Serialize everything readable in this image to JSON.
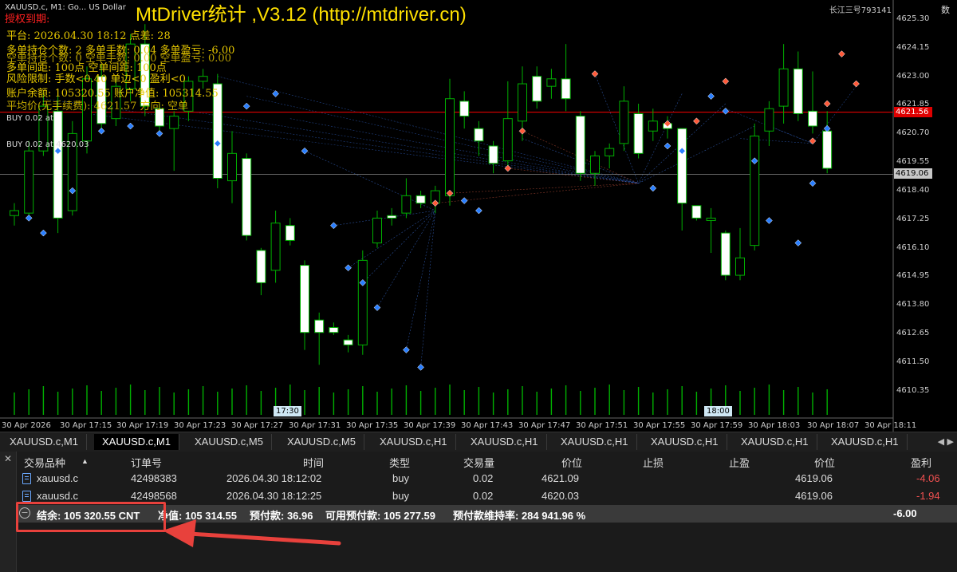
{
  "watermark": "MtDriver统计 ,V3.12 (http://mtdriver.cn)",
  "chart_header": {
    "symbol_line": "XAUUSD.c, M1:  Go...  US Dollar",
    "red_text": "授权到期:",
    "broker": "长江三号793141",
    "right_cut": "数"
  },
  "overlay_lines": [
    "平台: 2026.04.30 18:12       点差: 28",
    "多单持仓个数: 2   多单手数: 0.04   多单盈亏: -6.00",
    "空单持仓个数: 0   空单手数: 0.00   空单盈亏: 0.00",
    "多单间距: 100点   空单间距: 100点",
    "风险限制: 手数<0.40 单边<0 盈利<0",
    "账户余额: 105320.55   账户净值: 105314.55",
    "平均价(无手续费): 4621.57  方向: 空单"
  ],
  "buy_labels": [
    "BUY 0.02 at",
    "BUY 0.02 at 4620.03"
  ],
  "price_axis": [
    "4625.30",
    "4624.15",
    "4623.00",
    "4621.85",
    "4620.70",
    "4619.55",
    "4618.40",
    "4617.25",
    "4616.10",
    "4614.95",
    "4613.80",
    "4612.65",
    "4611.50",
    "4610.35"
  ],
  "price_tags": {
    "red_line": "4621.56",
    "current": "4619.06"
  },
  "time_axis": [
    "30 Apr 2026",
    "30 Apr 17:15",
    "30 Apr 17:19",
    "30 Apr 17:23",
    "30 Apr 17:27",
    "30 Apr 17:31",
    "30 Apr 17:35",
    "30 Apr 17:39",
    "30 Apr 17:43",
    "30 Apr 17:47",
    "30 Apr 17:51",
    "30 Apr 17:55",
    "30 Apr 17:59",
    "30 Apr 18:03",
    "30 Apr 18:07",
    "30 Apr 18:11"
  ],
  "time_badges": [
    "17:30",
    "18:00"
  ],
  "tabs": [
    "XAUUSD.c,M1",
    "XAUUSD.c,M1",
    "XAUUSD.c,M5",
    "XAUUSD.c,M5",
    "XAUUSD.c,H1",
    "XAUUSD.c,H1",
    "XAUUSD.c,H1",
    "XAUUSD.c,H1",
    "XAUUSD.c,H1",
    "XAUUSD.c,H1"
  ],
  "table": {
    "headers": {
      "symbol": "交易品种",
      "ticket": "订单号",
      "time": "时间",
      "type": "类型",
      "volume": "交易量",
      "price": "价位",
      "sl": "止损",
      "tp": "止盈",
      "cur_price": "价位",
      "profit": "盈利"
    },
    "rows": [
      {
        "symbol": "xauusd.c",
        "ticket": "42498383",
        "time": "2026.04.30 18:12:02",
        "type": "buy",
        "volume": "0.02",
        "price": "4621.09",
        "cur_price": "4619.06",
        "profit": "-4.06"
      },
      {
        "symbol": "xauusd.c",
        "ticket": "42498568",
        "time": "2026.04.30 18:12:25",
        "type": "buy",
        "volume": "0.02",
        "price": "4620.03",
        "cur_price": "4619.06",
        "profit": "-1.94"
      }
    ],
    "summary": {
      "balance": "结余: 105 320.55 CNT",
      "equity": "净值: 105 314.55",
      "margin": "预付款: 36.96",
      "free_margin": "可用预付款: 105 277.59",
      "margin_level": "预付款维持率: 284 941.96 %",
      "total": "-6.00"
    }
  },
  "colors": {
    "bull": "#00b000",
    "bear": "#ffffff",
    "price_line": "#ff2020",
    "highlight": "#e8413c"
  },
  "chart_data": {
    "type": "candlestick",
    "symbol": "XAUUSD.c",
    "timeframe": "M1",
    "ylim": [
      4610.35,
      4625.3
    ],
    "candles": [
      {
        "o": 4617.4,
        "h": 4617.9,
        "l": 4617.0,
        "c": 4617.6
      },
      {
        "o": 4617.5,
        "h": 4620.4,
        "l": 4617.3,
        "c": 4620.0
      },
      {
        "o": 4620.0,
        "h": 4622.4,
        "l": 4619.8,
        "c": 4621.8
      },
      {
        "o": 4621.6,
        "h": 4622.3,
        "l": 4616.7,
        "c": 4617.3
      },
      {
        "o": 4617.6,
        "h": 4621.2,
        "l": 4617.4,
        "c": 4620.7
      },
      {
        "o": 4620.4,
        "h": 4623.4,
        "l": 4619.9,
        "c": 4622.9
      },
      {
        "o": 4623.0,
        "h": 4623.5,
        "l": 4620.8,
        "c": 4621.1
      },
      {
        "o": 4621.3,
        "h": 4623.0,
        "l": 4621.0,
        "c": 4622.6
      },
      {
        "o": 4622.5,
        "h": 4624.7,
        "l": 4622.0,
        "c": 4624.3
      },
      {
        "o": 4624.3,
        "h": 4625.1,
        "l": 4621.4,
        "c": 4621.8
      },
      {
        "o": 4621.7,
        "h": 4621.9,
        "l": 4620.8,
        "c": 4621.0
      },
      {
        "o": 4620.9,
        "h": 4621.6,
        "l": 4619.2,
        "c": 4621.4
      },
      {
        "o": 4621.6,
        "h": 4623.0,
        "l": 4621.2,
        "c": 4622.8
      },
      {
        "o": 4622.8,
        "h": 4623.3,
        "l": 4622.5,
        "c": 4623.0
      },
      {
        "o": 4622.7,
        "h": 4623.1,
        "l": 4618.5,
        "c": 4618.9
      },
      {
        "o": 4618.8,
        "h": 4620.8,
        "l": 4617.9,
        "c": 4619.9
      },
      {
        "o": 4619.7,
        "h": 4619.9,
        "l": 4616.4,
        "c": 4616.6
      },
      {
        "o": 4616.0,
        "h": 4616.1,
        "l": 4614.2,
        "c": 4614.7
      },
      {
        "o": 4615.2,
        "h": 4617.6,
        "l": 4614.7,
        "c": 4617.1
      },
      {
        "o": 4617.0,
        "h": 4617.3,
        "l": 4616.2,
        "c": 4616.4
      },
      {
        "o": 4615.4,
        "h": 4615.6,
        "l": 4612.0,
        "c": 4612.7
      },
      {
        "o": 4613.2,
        "h": 4613.5,
        "l": 4611.4,
        "c": 4612.7
      },
      {
        "o": 4612.9,
        "h": 4613.1,
        "l": 4612.6,
        "c": 4612.7
      },
      {
        "o": 4612.4,
        "h": 4612.6,
        "l": 4611.9,
        "c": 4612.2
      },
      {
        "o": 4612.2,
        "h": 4616.0,
        "l": 4611.8,
        "c": 4615.6
      },
      {
        "o": 4616.3,
        "h": 4617.6,
        "l": 4616.1,
        "c": 4617.3
      },
      {
        "o": 4617.4,
        "h": 4617.7,
        "l": 4617.0,
        "c": 4617.3
      },
      {
        "o": 4617.5,
        "h": 4618.9,
        "l": 4617.3,
        "c": 4618.2
      },
      {
        "o": 4618.2,
        "h": 4618.4,
        "l": 4617.7,
        "c": 4617.9
      },
      {
        "o": 4617.9,
        "h": 4618.6,
        "l": 4617.5,
        "c": 4618.4
      },
      {
        "o": 4618.2,
        "h": 4622.9,
        "l": 4617.8,
        "c": 4622.1
      },
      {
        "o": 4622.0,
        "h": 4622.4,
        "l": 4620.9,
        "c": 4621.4
      },
      {
        "o": 4620.9,
        "h": 4621.2,
        "l": 4619.8,
        "c": 4620.4
      },
      {
        "o": 4620.2,
        "h": 4620.4,
        "l": 4619.1,
        "c": 4619.5
      },
      {
        "o": 4619.6,
        "h": 4622.8,
        "l": 4619.3,
        "c": 4621.3
      },
      {
        "o": 4621.2,
        "h": 4623.4,
        "l": 4620.4,
        "c": 4622.7
      },
      {
        "o": 4623.0,
        "h": 4623.4,
        "l": 4621.7,
        "c": 4622.0
      },
      {
        "o": 4622.6,
        "h": 4623.3,
        "l": 4622.1,
        "c": 4622.9
      },
      {
        "o": 4622.9,
        "h": 4624.3,
        "l": 4621.6,
        "c": 4622.1
      },
      {
        "o": 4621.4,
        "h": 4621.6,
        "l": 4618.8,
        "c": 4619.1
      },
      {
        "o": 4619.1,
        "h": 4620.0,
        "l": 4618.6,
        "c": 4619.8
      },
      {
        "o": 4619.8,
        "h": 4620.3,
        "l": 4619.3,
        "c": 4620.1
      },
      {
        "o": 4620.3,
        "h": 4622.6,
        "l": 4620.0,
        "c": 4622.0
      },
      {
        "o": 4621.5,
        "h": 4621.9,
        "l": 4619.7,
        "c": 4619.9
      },
      {
        "o": 4620.8,
        "h": 4621.7,
        "l": 4620.4,
        "c": 4621.2
      },
      {
        "o": 4621.1,
        "h": 4621.4,
        "l": 4620.5,
        "c": 4620.9
      },
      {
        "o": 4620.9,
        "h": 4620.9,
        "l": 4616.8,
        "c": 4617.9
      },
      {
        "o": 4617.8,
        "h": 4617.8,
        "l": 4617.2,
        "c": 4617.3
      },
      {
        "o": 4617.2,
        "h": 4617.7,
        "l": 4615.9,
        "c": 4617.3
      },
      {
        "o": 4616.7,
        "h": 4616.8,
        "l": 4614.8,
        "c": 4615.0
      },
      {
        "o": 4615.0,
        "h": 4616.9,
        "l": 4614.8,
        "c": 4615.7
      },
      {
        "o": 4616.2,
        "h": 4621.1,
        "l": 4616.0,
        "c": 4620.6
      },
      {
        "o": 4620.8,
        "h": 4622.0,
        "l": 4620.2,
        "c": 4621.7
      },
      {
        "o": 4621.8,
        "h": 4624.3,
        "l": 4621.1,
        "c": 4623.3
      },
      {
        "o": 4623.3,
        "h": 4624.0,
        "l": 4621.2,
        "c": 4621.5
      },
      {
        "o": 4621.6,
        "h": 4623.2,
        "l": 4620.7,
        "c": 4621.0
      },
      {
        "o": 4620.8,
        "h": 4621.6,
        "l": 4619.1,
        "c": 4619.3
      }
    ],
    "blue_markers": [
      [
        1,
        4617.3
      ],
      [
        2,
        4616.7
      ],
      [
        3,
        4620.0
      ],
      [
        4,
        4618.4
      ],
      [
        6,
        4620.8
      ],
      [
        8,
        4621.0
      ],
      [
        10,
        4620.7
      ],
      [
        14,
        4620.3
      ],
      [
        16,
        4621.8
      ],
      [
        18,
        4622.3
      ],
      [
        20,
        4620.0
      ],
      [
        22,
        4617.0
      ],
      [
        23,
        4615.3
      ],
      [
        24,
        4614.7
      ],
      [
        25,
        4613.7
      ],
      [
        27,
        4612.0
      ],
      [
        28,
        4611.3
      ],
      [
        31,
        4618.0
      ],
      [
        32,
        4617.6
      ],
      [
        44,
        4618.5
      ],
      [
        45,
        4620.2
      ],
      [
        46,
        4620.0
      ],
      [
        48,
        4622.2
      ],
      [
        49,
        4621.6
      ],
      [
        51,
        4619.6
      ],
      [
        52,
        4617.2
      ],
      [
        54,
        4616.3
      ],
      [
        55,
        4618.7
      ],
      [
        56,
        4620.9
      ]
    ],
    "red_markers": [
      [
        29,
        4617.9
      ],
      [
        30,
        4618.3
      ],
      [
        34,
        4619.3
      ],
      [
        35,
        4620.8
      ],
      [
        40,
        4623.1
      ],
      [
        45,
        4621.1
      ],
      [
        47,
        4621.2
      ],
      [
        49,
        4622.8
      ],
      [
        55,
        4620.4
      ],
      [
        56,
        4621.9
      ],
      [
        57,
        4623.9
      ],
      [
        58,
        4622.7
      ]
    ]
  }
}
